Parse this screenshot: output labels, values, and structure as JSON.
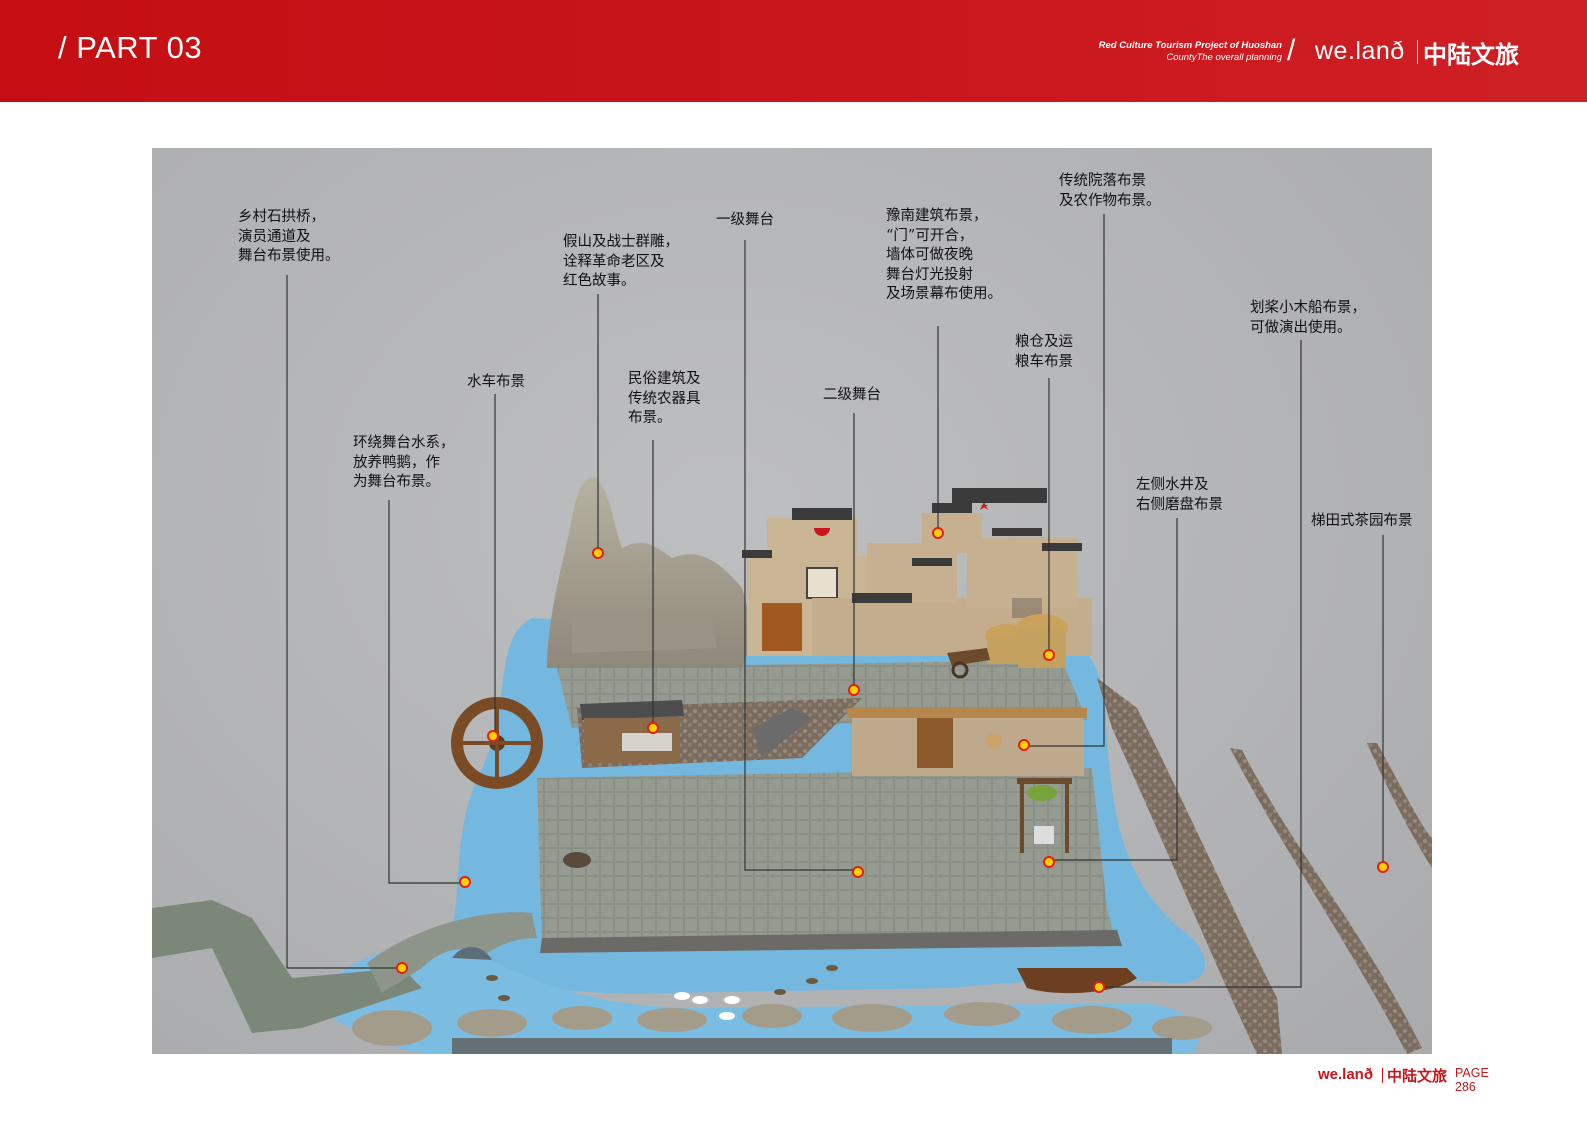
{
  "header": {
    "part": "/ PART 03",
    "subtitle_line1": "Red Culture Tourism Project of Huoshan",
    "subtitle_line2": "CountyThe overall planning",
    "slash": "/",
    "brand": "we.lanð",
    "brand_cn": "中陆文旅"
  },
  "labels": [
    {
      "id": "bridge",
      "text": "乡村石拱桥，\n演员通道及\n舞台布景使用。"
    },
    {
      "id": "rockery",
      "text": "假山及战士群雕，\n诠释革命老区及\n红色故事。"
    },
    {
      "id": "stage1",
      "text": "一级舞台"
    },
    {
      "id": "yunan",
      "text": "豫南建筑布景，\n“门”可开合，\n墙体可做夜晚\n舞台灯光投射\n及场景幕布使用。"
    },
    {
      "id": "courtyard",
      "text": "传统院落布景\n及农作物布景。"
    },
    {
      "id": "boat",
      "text": "划桨小木船布景，\n可做演出使用。"
    },
    {
      "id": "granary",
      "text": "粮仓及运\n粮车布景"
    },
    {
      "id": "waterwheel",
      "text": "水车布景"
    },
    {
      "id": "folk",
      "text": "民俗建筑及\n传统农器具\n布景。"
    },
    {
      "id": "stage2",
      "text": "二级舞台"
    },
    {
      "id": "waterway",
      "text": "环绕舞台水系，\n放养鸭鹅，作\n为舞台布景。"
    },
    {
      "id": "well",
      "text": "左侧水井及\n右侧磨盘布景"
    },
    {
      "id": "tea",
      "text": "梯田式茶园布景"
    }
  ],
  "colors": {
    "brand_red": "#c8161c",
    "marker_fill": "#ffd000",
    "marker_stroke": "#e02010"
  },
  "footer": {
    "brand": "we.lanð",
    "brand_cn": "中陆文旅",
    "page_label": "PAGE",
    "page_number": "286"
  }
}
